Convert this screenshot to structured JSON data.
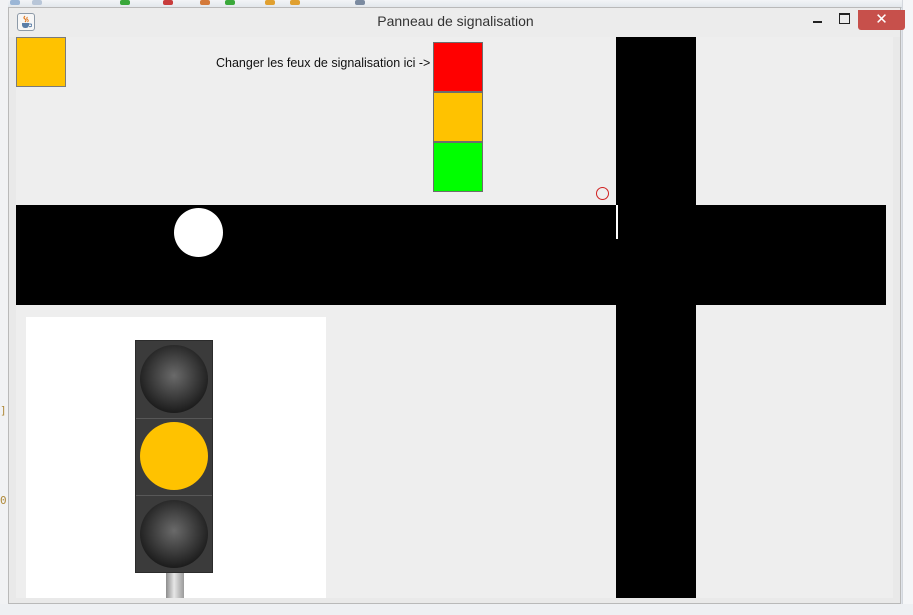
{
  "window": {
    "title": "Panneau de signalisation",
    "close_glyph": "✕",
    "icon": "java-cup-icon"
  },
  "panel": {
    "instruction": "Changer les feux de signalisation ici ->",
    "active_color": "#ffc200",
    "light_buttons": [
      {
        "name": "red",
        "color": "#ff0000"
      },
      {
        "name": "amber",
        "color": "#ffc200"
      },
      {
        "name": "green",
        "color": "#00ff00"
      }
    ]
  },
  "traffic_light": {
    "lamps": [
      {
        "name": "red-lamp",
        "state": "off"
      },
      {
        "name": "amber-lamp",
        "state": "on",
        "color": "#ffc200"
      },
      {
        "name": "green-lamp",
        "state": "off"
      }
    ]
  },
  "colors": {
    "road": "#000000",
    "car": "#ffffff",
    "panel_background": "#eeeeee",
    "close_button": "#c7504b"
  }
}
